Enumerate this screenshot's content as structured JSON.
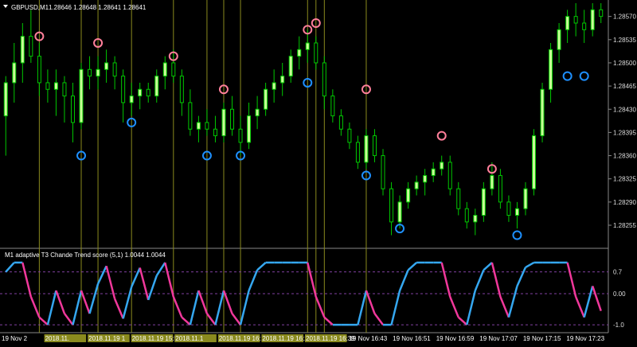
{
  "header": {
    "symbol_title": "GBPUSD,M1",
    "ohlc": "1.28646 1.28648 1.28641 1.28641",
    "indicator_title": "M1  adaptive T3 Chande Trend score (5,1) 1.0044 1.0044"
  },
  "colors": {
    "background": "#000000",
    "candle": "#00c800",
    "candle_body_up": "#c8ff96",
    "vline": "#8a8a1e",
    "arrow_up": "#1e90ff",
    "arrow_down": "#ff7f9a",
    "line_up": "#35a7f0",
    "line_down": "#f0389b",
    "level_line": "#8040a0",
    "price_tag_bg": "#ffffff"
  },
  "price_axis": {
    "labels": [
      "1.28570",
      "1.28535",
      "1.28500",
      "1.28465",
      "1.28430",
      "1.28395",
      "1.28360",
      "1.28325",
      "1.28290",
      "1.28255"
    ],
    "current": "1.28641",
    "ylim": [
      1.28225,
      1.2859
    ]
  },
  "indicator_axis": {
    "labels": [
      "0.7",
      "0.00",
      "-1.0"
    ]
  },
  "time_axis": {
    "labels": [
      "19 Nov 2",
      "2018.11.",
      "2018.11.19 1",
      "2018.11.19 15:5",
      "2018.11.1",
      "2018.11.19 16:13",
      "2018.11.19 16:27",
      "2018.11.19 16:39",
      "19 Nov 16:43",
      "19 Nov 16:51",
      "19 Nov 16:59",
      "19 Nov 17:07",
      "19 Nov 17:15",
      "19 Nov 17:23"
    ],
    "highlighted_count": 8
  },
  "chart_data": {
    "type": "candlestick",
    "symbol": "GBPUSD",
    "timeframe": "M1",
    "candles": [
      [
        1.2842,
        1.2848,
        1.2836,
        1.2847
      ],
      [
        1.2847,
        1.2853,
        1.2844,
        1.285
      ],
      [
        1.285,
        1.2856,
        1.2847,
        1.2854
      ],
      [
        1.2854,
        1.2858,
        1.285,
        1.2851
      ],
      [
        1.2851,
        1.2853,
        1.2845,
        1.2847
      ],
      [
        1.2847,
        1.2849,
        1.2844,
        1.2846
      ],
      [
        1.2846,
        1.2849,
        1.2842,
        1.2847
      ],
      [
        1.2847,
        1.2848,
        1.2841,
        1.2845
      ],
      [
        1.2845,
        1.2847,
        1.2838,
        1.2841
      ],
      [
        1.2841,
        1.285,
        1.284,
        1.2849
      ],
      [
        1.2849,
        1.2851,
        1.2846,
        1.2848
      ],
      [
        1.2848,
        1.2851,
        1.2846,
        1.2849
      ],
      [
        1.2849,
        1.2852,
        1.2847,
        1.285
      ],
      [
        1.285,
        1.2851,
        1.2846,
        1.2848
      ],
      [
        1.2848,
        1.2849,
        1.2841,
        1.2844
      ],
      [
        1.2844,
        1.2847,
        1.2842,
        1.2845
      ],
      [
        1.2845,
        1.2847,
        1.2843,
        1.2846
      ],
      [
        1.2846,
        1.2847,
        1.2844,
        1.2845
      ],
      [
        1.2845,
        1.2849,
        1.2844,
        1.2848
      ],
      [
        1.2848,
        1.2851,
        1.2846,
        1.285
      ],
      [
        1.285,
        1.2852,
        1.2847,
        1.2848
      ],
      [
        1.2848,
        1.2849,
        1.2842,
        1.2844
      ],
      [
        1.2844,
        1.2846,
        1.2839,
        1.284
      ],
      [
        1.284,
        1.2842,
        1.2838,
        1.2841
      ],
      [
        1.2841,
        1.2843,
        1.2839,
        1.284
      ],
      [
        1.284,
        1.2842,
        1.2838,
        1.2839
      ],
      [
        1.2839,
        1.2844,
        1.2838,
        1.2843
      ],
      [
        1.2843,
        1.2845,
        1.2839,
        1.284
      ],
      [
        1.284,
        1.2842,
        1.2836,
        1.2838
      ],
      [
        1.2838,
        1.2844,
        1.2837,
        1.2842
      ],
      [
        1.2842,
        1.2845,
        1.284,
        1.2843
      ],
      [
        1.2843,
        1.2847,
        1.2842,
        1.2846
      ],
      [
        1.2846,
        1.2849,
        1.2844,
        1.2847
      ],
      [
        1.2847,
        1.285,
        1.2845,
        1.2848
      ],
      [
        1.2848,
        1.2852,
        1.2847,
        1.2851
      ],
      [
        1.2851,
        1.2854,
        1.2849,
        1.2852
      ],
      [
        1.2852,
        1.2855,
        1.285,
        1.2853
      ],
      [
        1.2853,
        1.2854,
        1.2849,
        1.285
      ],
      [
        1.285,
        1.2851,
        1.2843,
        1.2845
      ],
      [
        1.2845,
        1.2846,
        1.2841,
        1.2842
      ],
      [
        1.2842,
        1.2843,
        1.2839,
        1.284
      ],
      [
        1.284,
        1.2841,
        1.2837,
        1.2838
      ],
      [
        1.2838,
        1.2839,
        1.2834,
        1.2835
      ],
      [
        1.2835,
        1.284,
        1.2834,
        1.2839
      ],
      [
        1.2839,
        1.284,
        1.2835,
        1.2836
      ],
      [
        1.2836,
        1.2837,
        1.283,
        1.2831
      ],
      [
        1.2831,
        1.2832,
        1.2824,
        1.2826
      ],
      [
        1.2826,
        1.283,
        1.2825,
        1.2829
      ],
      [
        1.2829,
        1.2832,
        1.2828,
        1.2831
      ],
      [
        1.2831,
        1.2833,
        1.283,
        1.2832
      ],
      [
        1.2832,
        1.2834,
        1.283,
        1.2833
      ],
      [
        1.2833,
        1.2835,
        1.2832,
        1.2834
      ],
      [
        1.2834,
        1.2836,
        1.2833,
        1.2835
      ],
      [
        1.2835,
        1.2836,
        1.283,
        1.2831
      ],
      [
        1.2831,
        1.2832,
        1.2827,
        1.2828
      ],
      [
        1.2828,
        1.2829,
        1.2825,
        1.2826
      ],
      [
        1.2826,
        1.2828,
        1.2824,
        1.2827
      ],
      [
        1.2827,
        1.2832,
        1.2826,
        1.2831
      ],
      [
        1.2831,
        1.2835,
        1.283,
        1.2833
      ],
      [
        1.2833,
        1.2834,
        1.2828,
        1.2829
      ],
      [
        1.2829,
        1.283,
        1.2826,
        1.2827
      ],
      [
        1.2827,
        1.2829,
        1.2825,
        1.2828
      ],
      [
        1.2828,
        1.2832,
        1.2827,
        1.2831
      ],
      [
        1.2831,
        1.284,
        1.283,
        1.2839
      ],
      [
        1.2839,
        1.2847,
        1.2838,
        1.2846
      ],
      [
        1.2846,
        1.2853,
        1.2844,
        1.2852
      ],
      [
        1.2852,
        1.2856,
        1.285,
        1.2855
      ],
      [
        1.2855,
        1.2858,
        1.2853,
        1.2857
      ],
      [
        1.2857,
        1.2859,
        1.2854,
        1.2856
      ],
      [
        1.2856,
        1.2858,
        1.2853,
        1.2855
      ],
      [
        1.2855,
        1.2859,
        1.2854,
        1.2858
      ],
      [
        1.2858,
        1.2859,
        1.2856,
        1.2857
      ]
    ],
    "signals": [
      {
        "i": 4,
        "type": "down",
        "price": 1.2854
      },
      {
        "i": 9,
        "type": "up",
        "price": 1.2836
      },
      {
        "i": 11,
        "type": "down",
        "price": 1.2853
      },
      {
        "i": 15,
        "type": "up",
        "price": 1.2841
      },
      {
        "i": 20,
        "type": "down",
        "price": 1.2851
      },
      {
        "i": 24,
        "type": "up",
        "price": 1.2836
      },
      {
        "i": 26,
        "type": "down",
        "price": 1.2846
      },
      {
        "i": 28,
        "type": "up",
        "price": 1.2836
      },
      {
        "i": 36,
        "type": "down",
        "price": 1.2855
      },
      {
        "i": 37,
        "type": "down",
        "price": 1.2856
      },
      {
        "i": 36,
        "type": "up",
        "price": 1.2847
      },
      {
        "i": 43,
        "type": "down",
        "price": 1.2846
      },
      {
        "i": 43,
        "type": "up",
        "price": 1.2833
      },
      {
        "i": 47,
        "type": "up",
        "price": 1.2825
      },
      {
        "i": 52,
        "type": "down",
        "price": 1.2839
      },
      {
        "i": 58,
        "type": "down",
        "price": 1.2834
      },
      {
        "i": 61,
        "type": "up",
        "price": 1.2824
      },
      {
        "i": 67,
        "type": "up",
        "price": 1.2848
      },
      {
        "i": 69,
        "type": "up",
        "price": 1.2848
      }
    ],
    "vertical_lines_at": [
      4,
      9,
      11,
      15,
      20,
      24,
      26,
      28,
      36,
      37,
      38,
      43
    ],
    "indicator": {
      "name": "adaptive T3 Chande Trend score",
      "params": "(5,1)",
      "values": [
        1.0044,
        1.0044
      ],
      "levels": [
        0.7,
        0.0,
        -1.0
      ],
      "ylim": [
        -1.1,
        1.1
      ]
    }
  }
}
